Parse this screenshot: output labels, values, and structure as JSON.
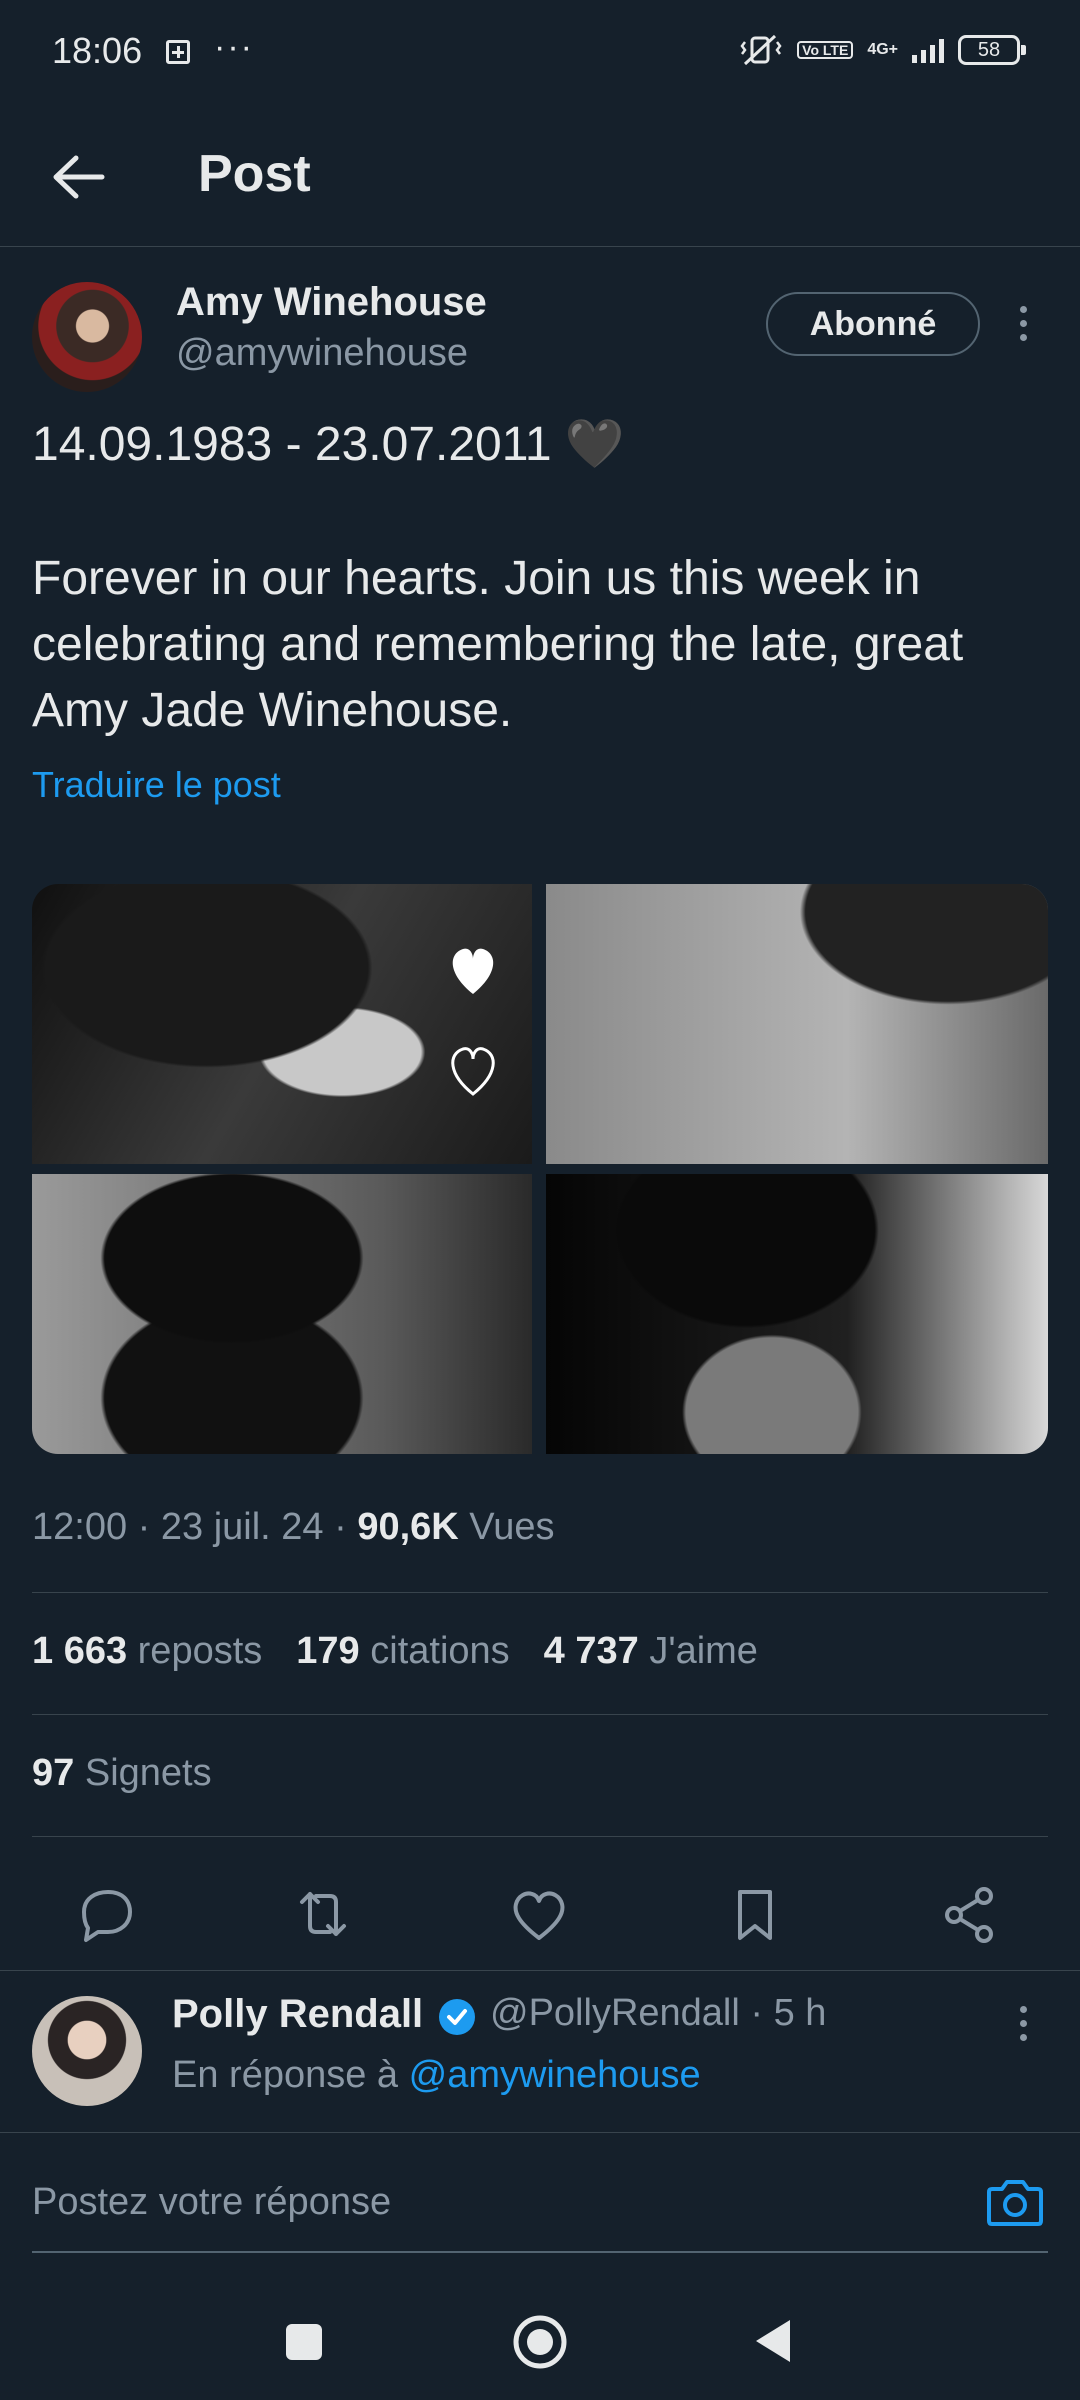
{
  "status_bar": {
    "time": "18:06",
    "network": "4G+",
    "volte": "Vo LTE",
    "battery": "58"
  },
  "header": {
    "title": "Post"
  },
  "post": {
    "author_name": "Amy Winehouse",
    "author_handle": "@amywinehouse",
    "follow_label": "Abonné",
    "text_line1": "14.09.1983 - 23.07.2011 🖤",
    "text_line2": "Forever in our hearts. Join us this week in",
    "text_line3": "celebrating and remembering the late, great",
    "text_line4": "Amy Jade Winehouse.",
    "translate_label": "Traduire le post",
    "time": "12:00",
    "date": "23 juil. 24",
    "views_count": "90,6K",
    "views_label": "Vues",
    "reposts_count": "1 663",
    "reposts_label": "reposts",
    "quotes_count": "179",
    "quotes_label": "citations",
    "likes_count": "4 737",
    "likes_label": "J'aime",
    "bookmarks_count": "97",
    "bookmarks_label": "Signets"
  },
  "reply": {
    "name": "Polly Rendall",
    "handle": "@PollyRendall",
    "time": "5 h",
    "in_reply_prefix": "En réponse à",
    "in_reply_handle": "@amywinehouse"
  },
  "composer": {
    "placeholder": "Postez votre réponse"
  },
  "colors": {
    "background": "#15202b",
    "accent": "#1d9bf0",
    "secondary_text": "#8b98a5",
    "divider": "#38444d"
  }
}
